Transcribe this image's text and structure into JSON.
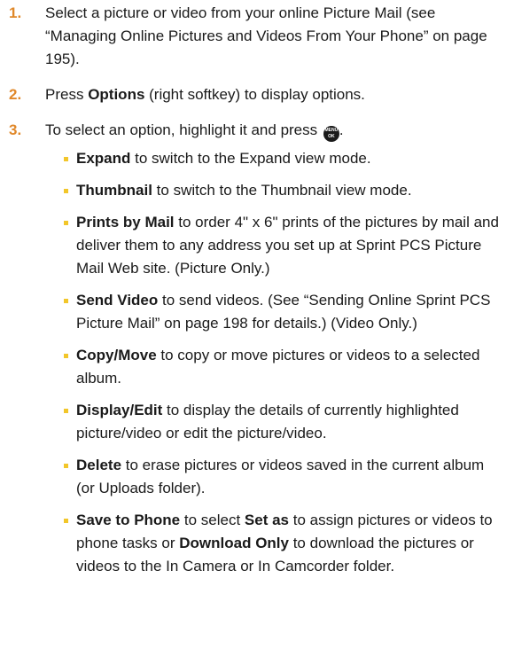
{
  "steps": [
    {
      "number": "1.",
      "text": "Select a picture or video from your online Picture Mail (see “Managing Online Pictures and Videos From Your Phone” on page 195)."
    },
    {
      "number": "2.",
      "pre": "Press ",
      "bold": "Options",
      "post": " (right softkey) to display options."
    },
    {
      "number": "3.",
      "pre": "To select an option, highlight it and press ",
      "key_top": "MENU",
      "key_bottom": "OK",
      "post": "."
    }
  ],
  "options": [
    {
      "bold": "Expand",
      "text": " to switch to the Expand view mode."
    },
    {
      "bold": "Thumbnail",
      "text": " to switch to the Thumbnail view mode."
    },
    {
      "bold": "Prints by Mail",
      "text": " to order 4\" x 6\" prints of the pictures by mail and deliver them to any address you set up at Sprint PCS Picture Mail Web site. (Picture Only.)"
    },
    {
      "bold": "Send Video",
      "text": " to send videos. (See “Sending Online Sprint PCS Picture Mail” on page 198 for details.) (Video Only.)"
    },
    {
      "bold": "Copy/Move",
      "text": " to copy or move pictures or videos to a selected album."
    },
    {
      "bold": "Display/Edit",
      "text": " to display the details of currently highlighted picture/video or edit the picture/video."
    },
    {
      "bold": "Delete",
      "text": " to erase pictures or videos saved in the current album (or Uploads folder)."
    }
  ],
  "last_option": {
    "bold": "Save to Phone",
    "t1": " to select ",
    "b2": "Set as",
    "t2": " to assign pictures or videos to phone tasks or ",
    "b3": "Download Only",
    "t3": " to download the pictures or videos to the In Camera or In Camcorder folder."
  },
  "colors": {
    "step_number": "#e0882a",
    "bullet": "#f2c62a",
    "text": "#1a1a1a"
  }
}
